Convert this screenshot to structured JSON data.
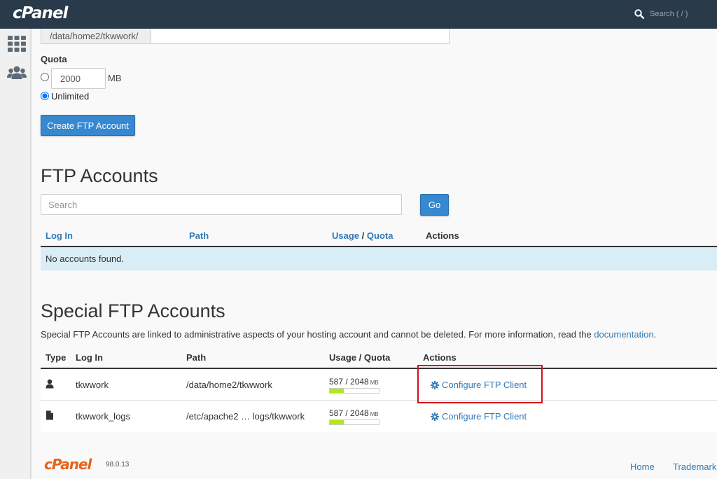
{
  "topbar": {
    "logo": "cPanel",
    "search_placeholder": "Search ( / )"
  },
  "sidebar": {
    "items": [
      {
        "icon": "apps-grid-icon"
      },
      {
        "icon": "users-icon"
      }
    ]
  },
  "create_form": {
    "directory_prefix": "/data/home2/tkwwork/",
    "quota_label": "Quota",
    "quota_value": "2000",
    "quota_unit": "MB",
    "unlimited_label": "Unlimited",
    "create_button": "Create FTP Account"
  },
  "ftp_accounts": {
    "title": "FTP Accounts",
    "search_placeholder": "Search",
    "go_button": "Go",
    "columns": {
      "login": "Log In",
      "path": "Path",
      "usage": "Usage",
      "separator": "/",
      "quota": "Quota",
      "actions": "Actions"
    },
    "empty_message": "No accounts found."
  },
  "special_ftp": {
    "title": "Special FTP Accounts",
    "description_text": "Special FTP Accounts are linked to administrative aspects of your hosting account and cannot be deleted. For more information, read the ",
    "description_link": "documentation",
    "description_end": ".",
    "columns": {
      "type": "Type",
      "login": "Log In",
      "path": "Path",
      "usage": "Usage / Quota",
      "actions": "Actions"
    },
    "rows": [
      {
        "type_icon": "user-icon",
        "login": "tkwwork",
        "path": "/data/home2/tkwwork",
        "usage": "587 / 2048",
        "unit": "MB",
        "usage_fraction": 0.287,
        "action": "Configure FTP Client"
      },
      {
        "type_icon": "file-icon",
        "login": "tkwwork_logs",
        "path": "/etc/apache2 … logs/tkwwork",
        "usage": "587 / 2048",
        "unit": "MB",
        "usage_fraction": 0.287,
        "action": "Configure FTP Client"
      }
    ]
  },
  "footer": {
    "logo": "cPanel",
    "version": "98.0.13",
    "home_link": "Home",
    "trademarks_link": "Trademarks"
  },
  "colors": {
    "topbar_bg": "#293a4a",
    "primary_button": "#3688d0",
    "link": "#337ab7",
    "info_row_bg": "#d9edf7",
    "usage_bar_fill": "#b5e61d",
    "highlight_box": "#d0131b",
    "footer_logo": "#e8631c"
  }
}
